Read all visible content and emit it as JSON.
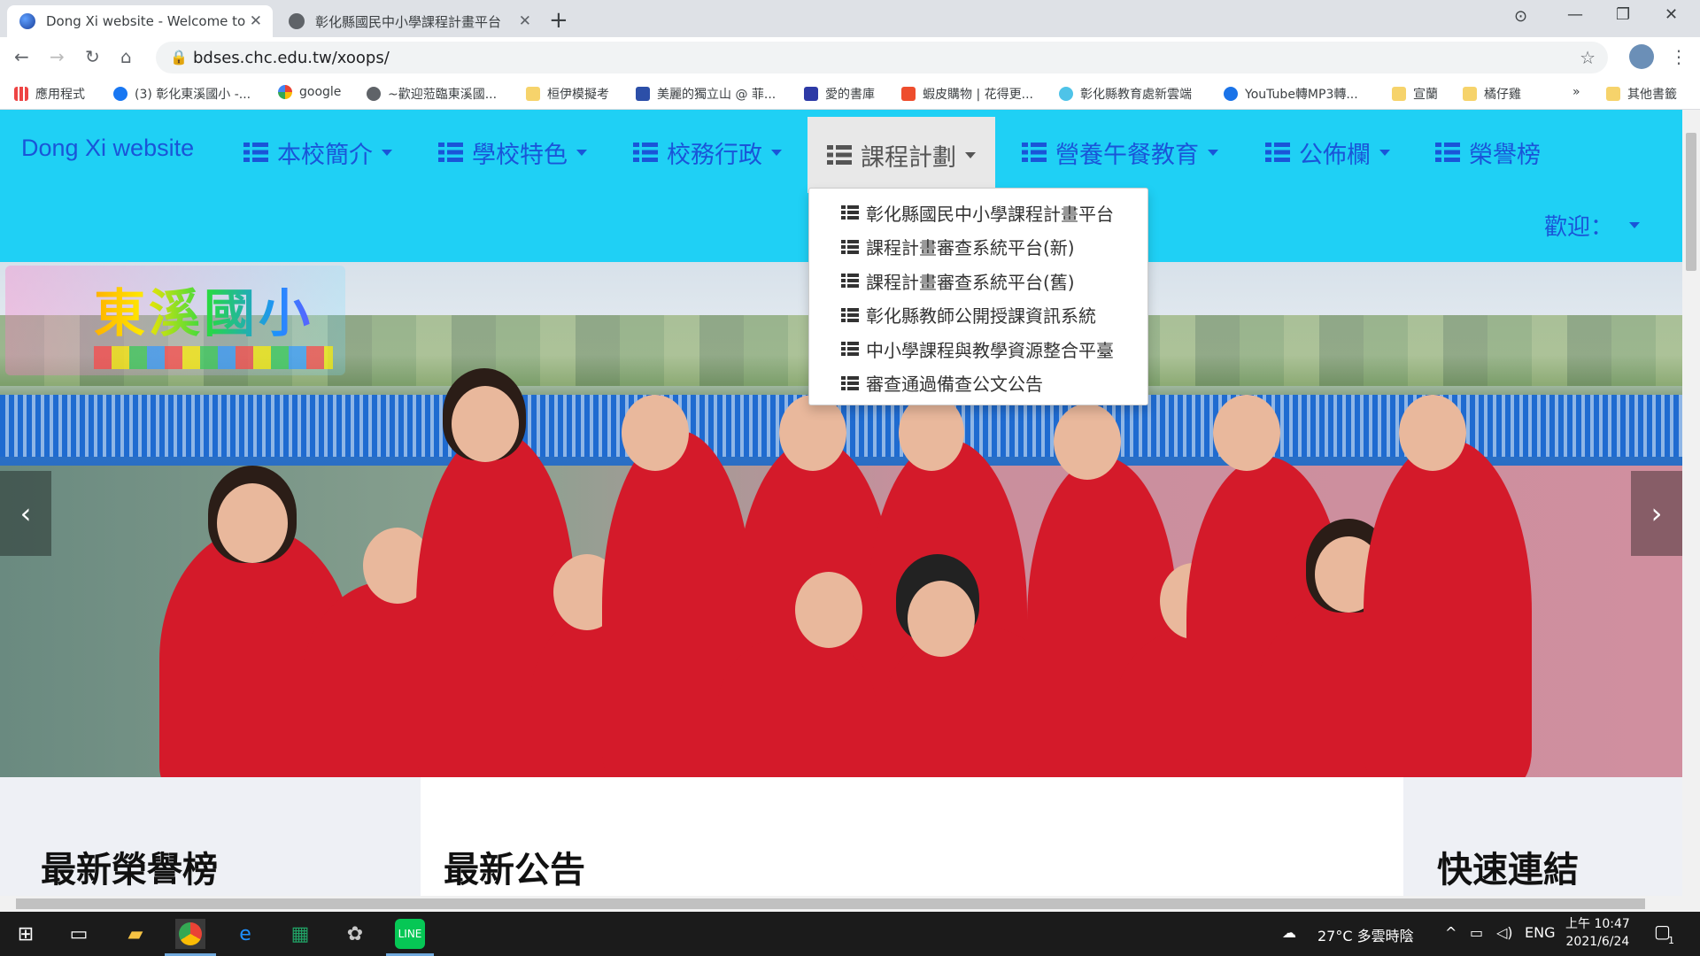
{
  "browser": {
    "tabs": [
      {
        "title": "Dong Xi website - Welcome to",
        "active": true
      },
      {
        "title": "彰化縣國民中小學課程計畫平台",
        "active": false
      }
    ],
    "url": "bdses.chc.edu.tw/xoops/",
    "bookmarks": [
      {
        "label": "應用程式",
        "icon": "apps-grid-icon"
      },
      {
        "label": "(3) 彰化東溪國小 -...",
        "icon": "facebook-icon"
      },
      {
        "label": "google",
        "icon": "google-icon"
      },
      {
        "label": "~歡迎蒞臨東溪國...",
        "icon": "globe-icon"
      },
      {
        "label": "桓伊模擬考",
        "icon": "folder-icon"
      },
      {
        "label": "美麗的獨立山 @ 菲...",
        "icon": "blog-icon"
      },
      {
        "label": "愛的書庫",
        "icon": "library-icon"
      },
      {
        "label": "蝦皮購物 | 花得更...",
        "icon": "shopee-icon"
      },
      {
        "label": "彰化縣教育處新雲端",
        "icon": "cloud-icon"
      },
      {
        "label": "YouTube轉MP3轉...",
        "icon": "download-icon"
      },
      {
        "label": "宣蘭",
        "icon": "folder-icon"
      },
      {
        "label": "橘仔雞",
        "icon": "folder-icon"
      },
      {
        "label": "其他書籤",
        "icon": "folder-icon"
      }
    ],
    "more_bookmarks": "»"
  },
  "site": {
    "brand": "Dong Xi website",
    "menu": [
      {
        "label": "本校簡介",
        "has_caret": true
      },
      {
        "label": "學校特色",
        "has_caret": true
      },
      {
        "label": "校務行政",
        "has_caret": true
      },
      {
        "label": "課程計劃",
        "has_caret": true,
        "active": true
      },
      {
        "label": "營養午餐教育",
        "has_caret": true
      },
      {
        "label": "公佈欄",
        "has_caret": true
      },
      {
        "label": "榮譽榜",
        "has_caret": false
      }
    ],
    "dropdown": [
      "彰化縣國民中小學課程計畫平台",
      "課程計畫審查系統平台(新)",
      "課程計畫審查系統平台(舊)",
      "彰化縣教師公開授課資訊系統",
      "中小學課程與教學資源整合平臺",
      "審查通過備查公文公告"
    ],
    "welcome": "歡迎：",
    "logo_text": "東溪國小",
    "carousel": {
      "prev": "‹",
      "next": "›"
    },
    "panels": {
      "honor": "最新榮譽榜",
      "news": "最新公告",
      "links": "快速連結"
    }
  },
  "taskbar": {
    "weather": "27°C 多雲時陰",
    "lang": "ENG",
    "time": "上午 10:47",
    "date": "2021/6/24",
    "notifications": "1"
  },
  "colors": {
    "navbar": "#1fd0f5",
    "menu_text": "#1a55d8"
  }
}
